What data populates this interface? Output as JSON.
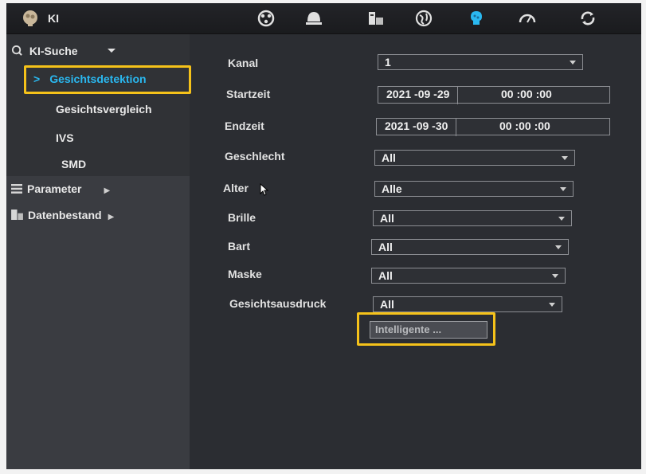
{
  "header": {
    "title": "KI",
    "logo_icon": "ai-head-icon",
    "icons": [
      {
        "name": "camera-reel-icon"
      },
      {
        "name": "dome-camera-icon"
      },
      {
        "name": "storage-device-icon"
      },
      {
        "name": "network-globe-icon"
      },
      {
        "name": "ai-brain-icon",
        "active": true
      },
      {
        "name": "performance-gauge-icon"
      },
      {
        "name": "refresh-sync-icon"
      }
    ],
    "active_color": "#2ab8f0"
  },
  "sidebar": {
    "group_label": "KI-Suche",
    "items": [
      {
        "label": "Gesichtsdetektion",
        "marker": ">",
        "active": true
      },
      {
        "label": "Gesichtsvergleich"
      },
      {
        "label": "IVS"
      },
      {
        "label": "SMD"
      }
    ],
    "sections": [
      {
        "label": "Parameter"
      },
      {
        "label": "Datenbestand"
      }
    ]
  },
  "form": {
    "kanal": {
      "label": "Kanal",
      "value": "1"
    },
    "startzeit": {
      "label": "Startzeit",
      "date": "2021 -09 -29",
      "time": "00 :00 :00"
    },
    "endzeit": {
      "label": "Endzeit",
      "date": "2021 -09 -30",
      "time": "00 :00 :00"
    },
    "geschlecht": {
      "label": "Geschlecht",
      "value": "All"
    },
    "alter": {
      "label": "Alter",
      "value": "Alle"
    },
    "brille": {
      "label": "Brille",
      "value": "All"
    },
    "bart": {
      "label": "Bart",
      "value": "All"
    },
    "maske": {
      "label": "Maske",
      "value": "All"
    },
    "gesichtsausdruck": {
      "label": "Gesichtsausdruck",
      "value": "All"
    },
    "smart_button": "Intelligente ..."
  },
  "highlight_color": "#f5c21a"
}
